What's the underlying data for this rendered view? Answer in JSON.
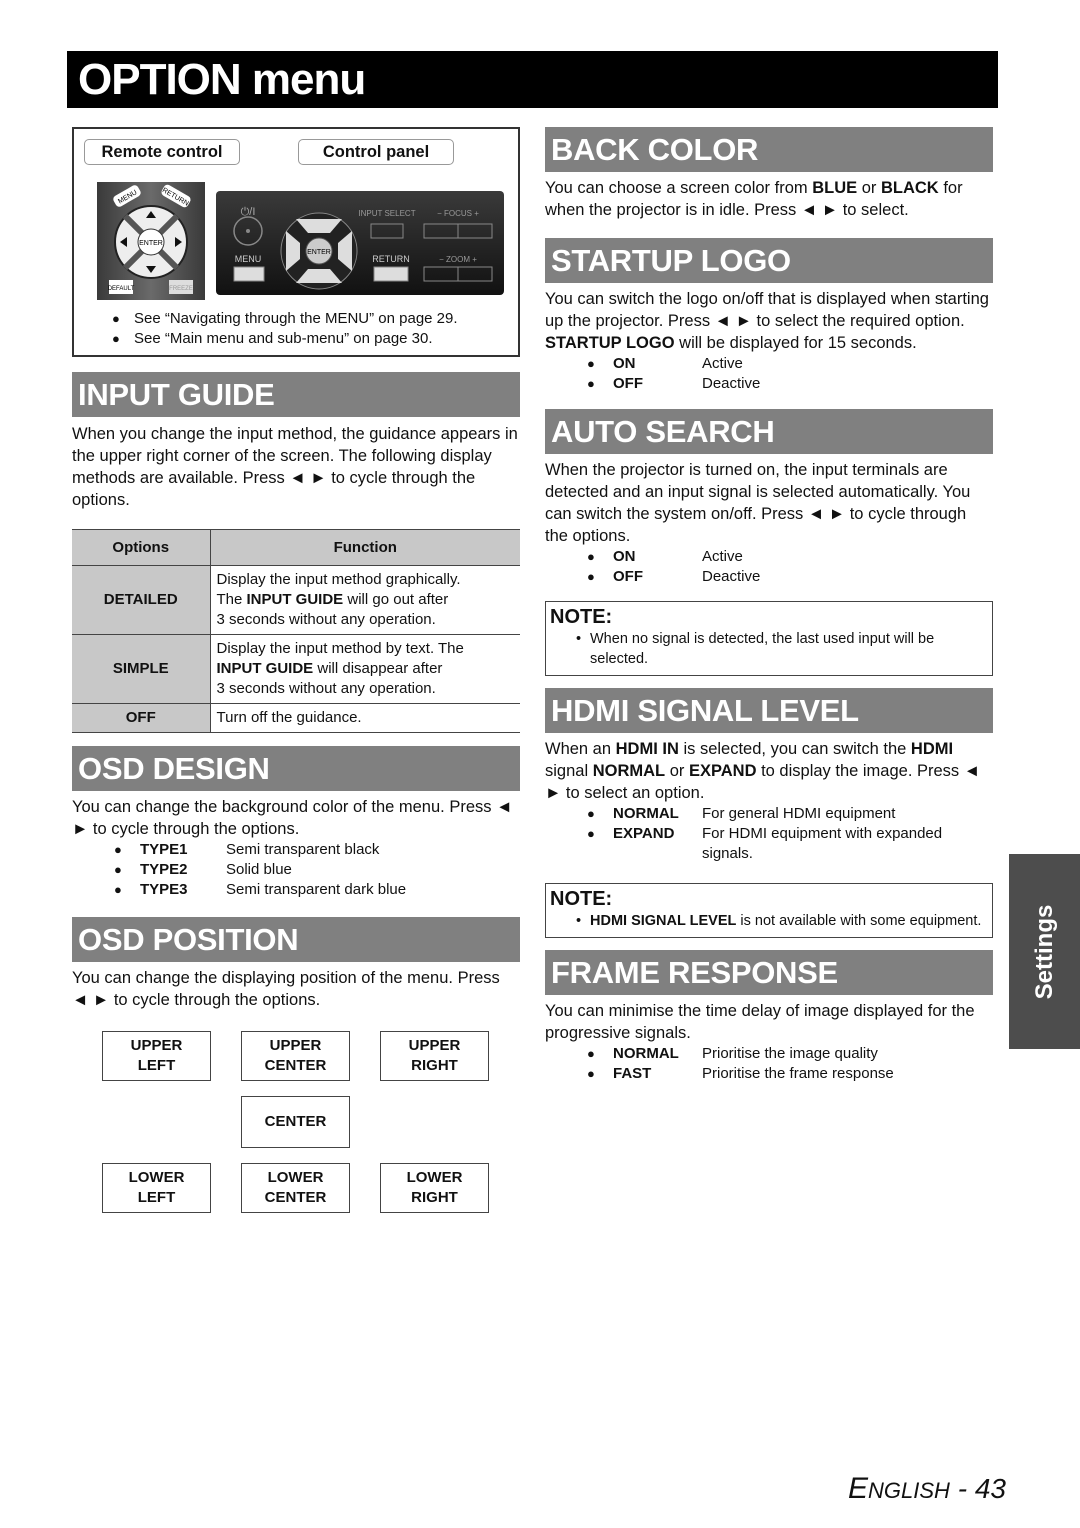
{
  "page": {
    "title": "OPTION menu",
    "side_tab": "Settings",
    "footer": {
      "lang_initial": "E",
      "lang_rest": "NGLISH",
      "separator": " - ",
      "page_number": "43"
    }
  },
  "controls": {
    "remote_tab": "Remote control",
    "panel_tab": "Control panel",
    "remote_buttons": [
      "MENU",
      "RETURN",
      "ENTER",
      "DEFAULT",
      "FREEZE"
    ],
    "panel_labels": [
      "INPUT SELECT",
      "FOCUS",
      "MENU",
      "ENTER",
      "RETURN",
      "ZOOM"
    ],
    "notes": [
      "See “Navigating through the MENU” on page 29.",
      "See “Main menu and sub-menu” on page 30."
    ]
  },
  "input_guide": {
    "heading": "INPUT GUIDE",
    "intro": "When you change the input method, the guidance appears in the upper right corner of the screen. The following display methods are available. Press ◄ ► to cycle through the options.",
    "table": {
      "headers": [
        "Options",
        "Function"
      ],
      "rows": [
        {
          "option": "DETAILED",
          "lines": [
            "Display the input method graphically.",
            "The INPUT GUIDE will go out after",
            "3 seconds without any operation."
          ]
        },
        {
          "option": "SIMPLE",
          "lines": [
            "Display the input method by text. The",
            "INPUT GUIDE will disappear after",
            "3 seconds without any operation."
          ]
        },
        {
          "option": "OFF",
          "lines": [
            "Turn off the guidance."
          ]
        }
      ],
      "bold_term": "INPUT GUIDE"
    }
  },
  "osd_design": {
    "heading": "OSD DESIGN",
    "intro": "You can change the background color of the menu. Press ◄ ► to cycle through the options.",
    "options": [
      {
        "key": "TYPE1",
        "value": "Semi transparent black"
      },
      {
        "key": "TYPE2",
        "value": "Solid blue"
      },
      {
        "key": "TYPE3",
        "value": "Semi transparent dark blue"
      }
    ]
  },
  "osd_position": {
    "heading": "OSD POSITION",
    "intro": "You can change the displaying position of the menu. Press ◄ ► to cycle through the options.",
    "positions": {
      "upper_left": [
        "UPPER",
        "LEFT"
      ],
      "upper_center": [
        "UPPER",
        "CENTER"
      ],
      "upper_right": [
        "UPPER",
        "RIGHT"
      ],
      "center": [
        "CENTER"
      ],
      "lower_left": [
        "LOWER",
        "LEFT"
      ],
      "lower_center": [
        "LOWER",
        "CENTER"
      ],
      "lower_right": [
        "LOWER",
        "RIGHT"
      ]
    }
  },
  "back_color": {
    "heading": "BACK COLOR",
    "text_a": "You can choose a screen color from ",
    "bold_a": "BLUE",
    "text_b": " or ",
    "bold_b": "BLACK",
    "text_c": " for when the projector is in idle. Press ◄ ► to select."
  },
  "startup_logo": {
    "heading": "STARTUP LOGO",
    "text_a": "You can switch the logo on/off that is displayed when starting up the projector. Press ◄ ► to select the required option. ",
    "bold_a": "STARTUP LOGO",
    "text_b": " will be displayed for 15 seconds.",
    "options": [
      {
        "key": "ON",
        "value": "Active"
      },
      {
        "key": "OFF",
        "value": "Deactive"
      }
    ]
  },
  "auto_search": {
    "heading": "AUTO SEARCH",
    "intro": "When the projector is turned on, the input terminals are detected and an input signal is selected automatically. You can switch the system on/off. Press ◄ ► to cycle through the options.",
    "options": [
      {
        "key": "ON",
        "value": "Active"
      },
      {
        "key": "OFF",
        "value": "Deactive"
      }
    ],
    "note_title": "NOTE:",
    "note": "When no signal is detected, the last used input will be selected."
  },
  "hdmi_signal_level": {
    "heading": "HDMI SIGNAL LEVEL",
    "t1": "When an ",
    "b1": "HDMI IN",
    "t2": " is selected, you can switch the ",
    "b2": "HDMI",
    "t3": " signal ",
    "b3": "NORMAL",
    "t4": " or ",
    "b4": "EXPAND",
    "t5": " to display the image. Press ◄ ► to select an option.",
    "options": [
      {
        "key": "NORMAL",
        "value": "For general HDMI equipment"
      },
      {
        "key": "EXPAND",
        "value": "For HDMI equipment with expanded signals."
      }
    ],
    "note_title": "NOTE:",
    "note_bold": "HDMI SIGNAL LEVEL",
    "note_rest": " is not available with some equipment."
  },
  "frame_response": {
    "heading": "FRAME RESPONSE",
    "intro": "You can minimise the time delay of image displayed for the progressive signals.",
    "options": [
      {
        "key": "NORMAL",
        "value": "Prioritise the image quality"
      },
      {
        "key": "FAST",
        "value": "Prioritise the frame response"
      }
    ]
  }
}
